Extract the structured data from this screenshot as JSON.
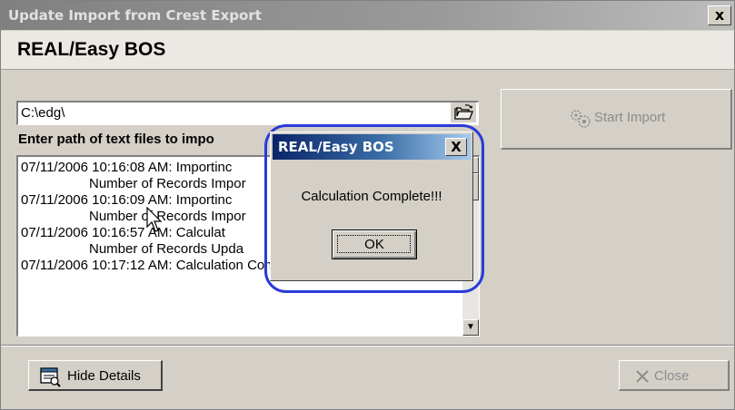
{
  "window": {
    "title": "Update Import from Crest Export",
    "close_glyph": "x"
  },
  "header": {
    "app_name": "REAL/Easy BOS"
  },
  "path_field": {
    "value": "C:\\edg\\",
    "label": "Enter path of text files to impo"
  },
  "log": {
    "lines": [
      "07/11/2006 10:16:08 AM: Importinc",
      "Number of Records Impor",
      "07/11/2006 10:16:09 AM: Importinc",
      "Number of Records Impor",
      "07/11/2006 10:16:57 AM: Calculat",
      "Number of Records Upda",
      "07/11/2006 10:17:12 AM: Calculation Complete!!!"
    ],
    "scroll_up_glyph": "▲",
    "scroll_down_glyph": "▼"
  },
  "buttons": {
    "start_import": "Start Import",
    "hide_details": "Hide Details",
    "close": "Close"
  },
  "dialog": {
    "title": "REAL/Easy BOS",
    "close_glyph": "X",
    "message": "Calculation Complete!!!",
    "ok_label": "OK"
  },
  "colors": {
    "dialog_title_start": "#0a246a",
    "highlight_ring": "#2a3bd6",
    "disabled_text": "#8c8c8c"
  },
  "icons": [
    "folder-open-icon",
    "start-import-icon",
    "hide-details-icon",
    "close-x-icon",
    "mouse-cursor-icon"
  ]
}
